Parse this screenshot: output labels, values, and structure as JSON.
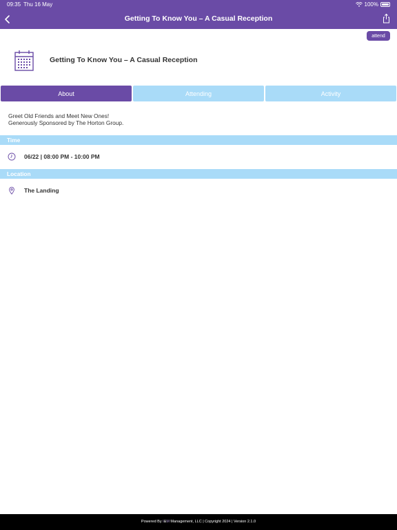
{
  "status_bar": {
    "time": "09:35",
    "date": "Thu 16 May",
    "battery": "100%"
  },
  "header": {
    "title": "Getting To Know You – A Casual Reception"
  },
  "attend_button": "attend",
  "event": {
    "title": "Getting To Know You – A Casual Reception"
  },
  "tabs": [
    {
      "label": "About",
      "active": true
    },
    {
      "label": "Attending",
      "active": false
    },
    {
      "label": "Activity",
      "active": false
    }
  ],
  "description": {
    "line1": "Greet Old Friends and Meet New Ones!",
    "line2": "Generously Sponsored by The Horton Group."
  },
  "sections": {
    "time": {
      "header": "Time",
      "value": "06/22 | 08:00 PM - 10:00 PM",
      "icon": "clock-icon"
    },
    "location": {
      "header": "Location",
      "value": "The Landing",
      "icon": "map-pin-icon"
    }
  },
  "footer": {
    "prefix": "Powered By ",
    "brand_i": "I",
    "amp": "&",
    "brand_m": "M",
    "suffix": " Management, LLC | Copyright 2024 | Version 2.1.0"
  },
  "colors": {
    "primary": "#6a4ba6",
    "secondary": "#a9dbf8",
    "footer": "#000000"
  }
}
